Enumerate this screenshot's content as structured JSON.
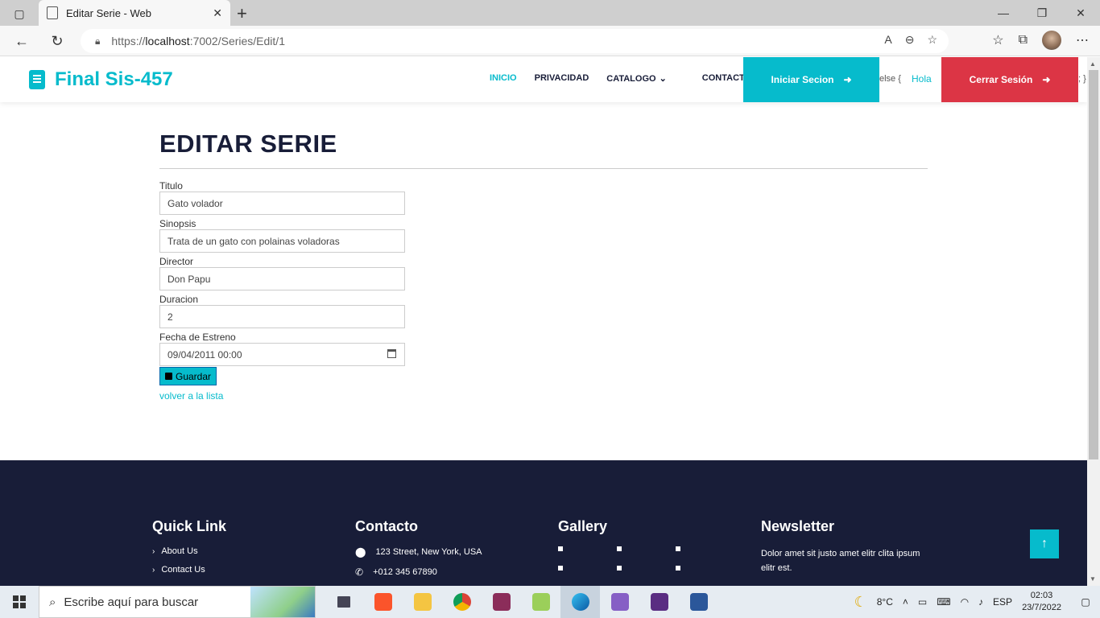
{
  "browser": {
    "tab_title": "Editar Serie - Web",
    "url_prefix": "https://",
    "url_host": "localhost",
    "url_path": ":7002/Series/Edit/1"
  },
  "site": {
    "brand": "Final Sis-457",
    "nav": {
      "inicio": "INICIO",
      "privacidad": "PRIVACIDAD",
      "catalogo": "CATALOGO",
      "contacto": "CONTACTO"
    },
    "login_button": "Iniciar Secion",
    "razor_else": "else {",
    "greeting": "Hola",
    "logout_button": "Cerrar Sesión",
    "razor_close": "; }"
  },
  "page": {
    "title": "EDITAR SERIE",
    "fields": {
      "titulo_label": "Titulo",
      "titulo_value": "Gato volador",
      "sinopsis_label": "Sinopsis",
      "sinopsis_value": "Trata de un gato con polainas voladoras",
      "director_label": "Director",
      "director_value": "Don Papu",
      "duracion_label": "Duracion",
      "duracion_value": "2",
      "fecha_label": "Fecha de Estreno",
      "fecha_value": "09/04/2011 00:00"
    },
    "save_button": "Guardar",
    "back_link": "volver a la lista"
  },
  "footer": {
    "quick_link_title": "Quick Link",
    "quick_links": [
      "About Us",
      "Contact Us"
    ],
    "contact_title": "Contacto",
    "address": "123 Street, New York, USA",
    "phone": "+012 345 67890",
    "gallery_title": "Gallery",
    "newsletter_title": "Newsletter",
    "newsletter_text": "Dolor amet sit justo amet elitr clita ipsum elitr est."
  },
  "taskbar": {
    "search_placeholder": "Escribe aquí para buscar",
    "temperature": "8°C",
    "language": "ESP",
    "time": "02:03",
    "date": "23/7/2022"
  },
  "colors": {
    "accent": "#06bbcc",
    "dark": "#181d38",
    "danger": "#dc3545"
  }
}
